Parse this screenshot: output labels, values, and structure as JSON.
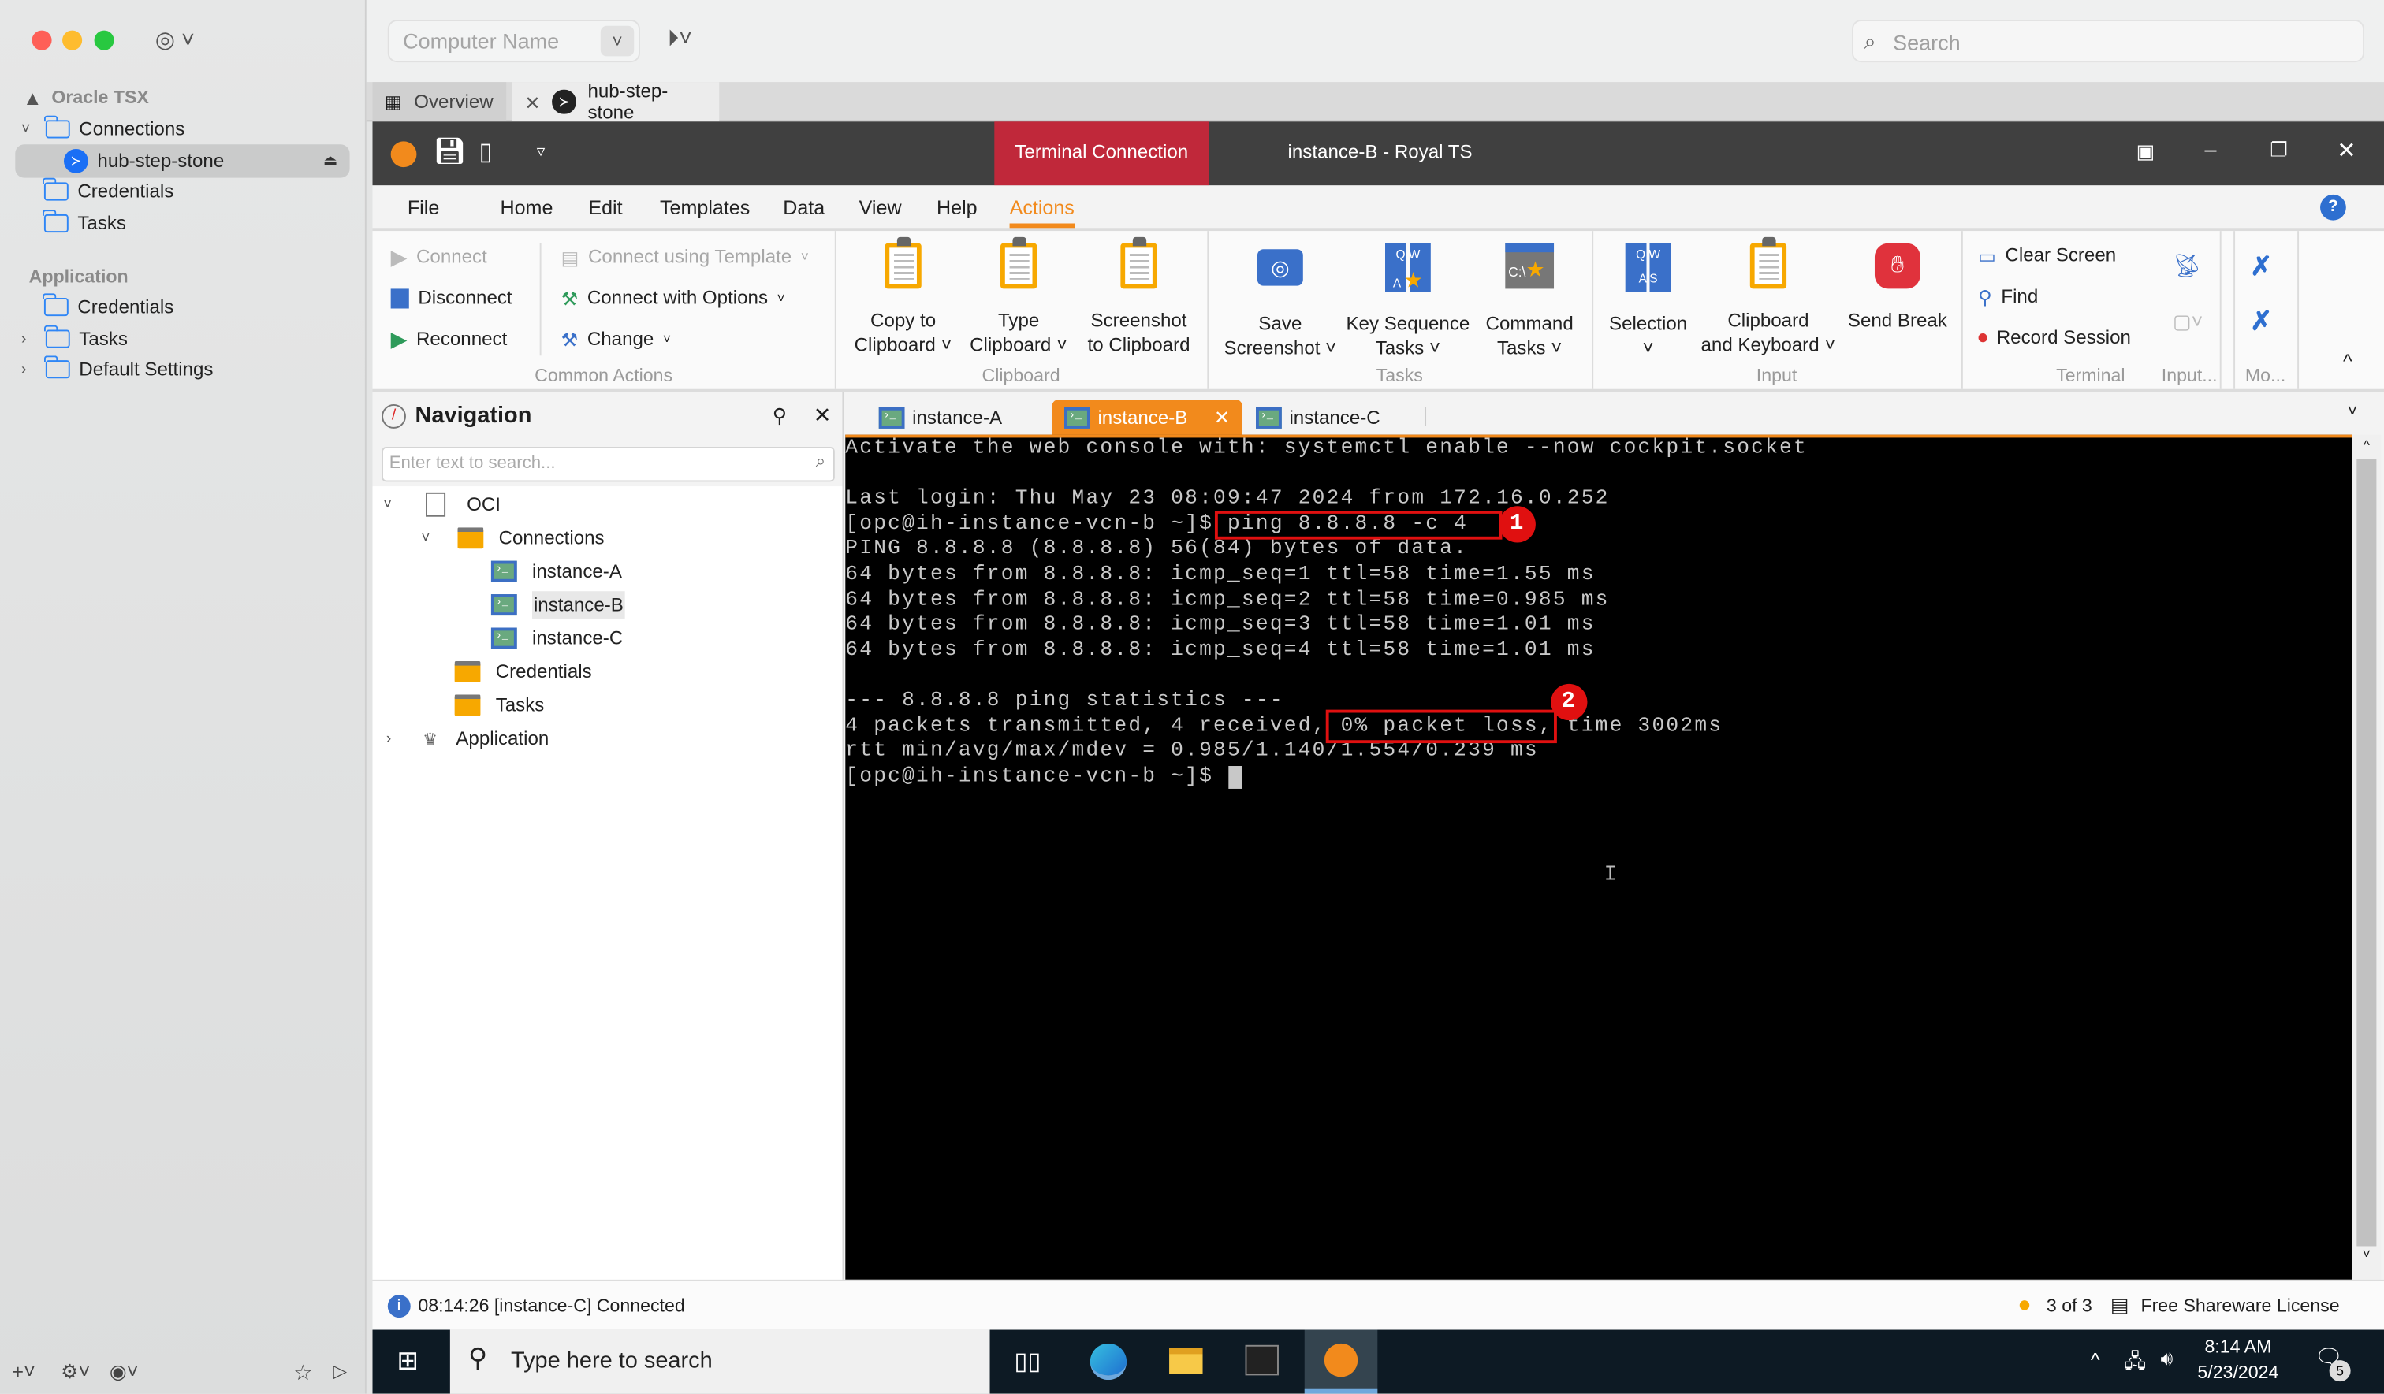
{
  "mac_sidebar": {
    "workspace": "Oracle TSX",
    "items": [
      {
        "label": "Connections"
      },
      {
        "label": "hub-step-stone"
      },
      {
        "label": "Credentials"
      },
      {
        "label": "Tasks"
      }
    ],
    "application_section": "Application",
    "application_items": [
      {
        "label": "Credentials"
      },
      {
        "label": "Tasks"
      },
      {
        "label": "Default Settings"
      }
    ]
  },
  "toolbar": {
    "computer_name_placeholder": "Computer Name",
    "search_placeholder": "Search"
  },
  "tabs": [
    {
      "label": "Overview"
    },
    {
      "label": "hub-step-stone",
      "active": true
    }
  ],
  "royal": {
    "context_tab": "Terminal Connection",
    "window_title": "instance-B - Royal TS",
    "menu": [
      "File",
      "Home",
      "Edit",
      "Templates",
      "Data",
      "View",
      "Help",
      "Actions"
    ],
    "active_menu": "Actions",
    "accent": "#f28a1c",
    "ribbon": {
      "common_actions": {
        "label": "Common Actions",
        "connect": "Connect",
        "disconnect": "Disconnect",
        "reconnect": "Reconnect",
        "connect_template": "Connect using Template",
        "connect_options": "Connect with Options",
        "change": "Change"
      },
      "clipboard": {
        "label": "Clipboard",
        "copy": [
          "Copy to",
          "Clipboard"
        ],
        "type": [
          "Type",
          "Clipboard"
        ],
        "screenshot": [
          "Screenshot",
          "to Clipboard"
        ]
      },
      "tasks": {
        "label": "Tasks",
        "save": [
          "Save",
          "Screenshot"
        ],
        "key": [
          "Key Sequence",
          "Tasks"
        ],
        "command": [
          "Command",
          "Tasks"
        ]
      },
      "input": {
        "label": "Input",
        "selection": "Selection",
        "clipkey": [
          "Clipboard",
          "and Keyboard"
        ],
        "send_break": "Send Break"
      },
      "terminal": {
        "label": "Terminal",
        "clear": "Clear Screen",
        "find": "Find",
        "record": "Record Session"
      },
      "input2_label": "Input...",
      "more_label": "Mo..."
    },
    "navigation": {
      "title": "Navigation",
      "search_placeholder": "Enter text to search...",
      "tree": {
        "root": "OCI",
        "connections": "Connections",
        "instances": [
          "instance-A",
          "instance-B",
          "instance-C"
        ],
        "selected": "instance-B",
        "credentials": "Credentials",
        "tasks": "Tasks",
        "application": "Application"
      }
    },
    "doc_tabs": [
      {
        "label": "instance-A"
      },
      {
        "label": "instance-B",
        "active": true
      },
      {
        "label": "instance-C"
      }
    ],
    "terminal": {
      "lines": [
        "Activate the web console with: systemctl enable --now cockpit.socket",
        "",
        "Last login: Thu May 23 08:09:47 2024 from 172.16.0.252",
        "[opc@ih-instance-vcn-b ~]$ ping 8.8.8.8 -c 4",
        "PING 8.8.8.8 (8.8.8.8) 56(84) bytes of data.",
        "64 bytes from 8.8.8.8: icmp_seq=1 ttl=58 time=1.55 ms",
        "64 bytes from 8.8.8.8: icmp_seq=2 ttl=58 time=0.985 ms",
        "64 bytes from 8.8.8.8: icmp_seq=3 ttl=58 time=1.01 ms",
        "64 bytes from 8.8.8.8: icmp_seq=4 ttl=58 time=1.01 ms",
        "",
        "--- 8.8.8.8 ping statistics ---",
        "4 packets transmitted, 4 received, 0% packet loss, time 3002ms",
        "rtt min/avg/max/mdev = 0.985/1.140/1.554/0.239 ms",
        "[opc@ih-instance-vcn-b ~]$ "
      ],
      "annotations": [
        "1",
        "2"
      ],
      "annotation_color": "#e01010"
    },
    "status": {
      "message": "08:14:26 [instance-C] Connected",
      "count": "3 of 3",
      "license": "Free Shareware License"
    }
  },
  "taskbar": {
    "search_placeholder": "Type here to search",
    "time": "8:14 AM",
    "date": "5/23/2024",
    "notifications": "5"
  }
}
